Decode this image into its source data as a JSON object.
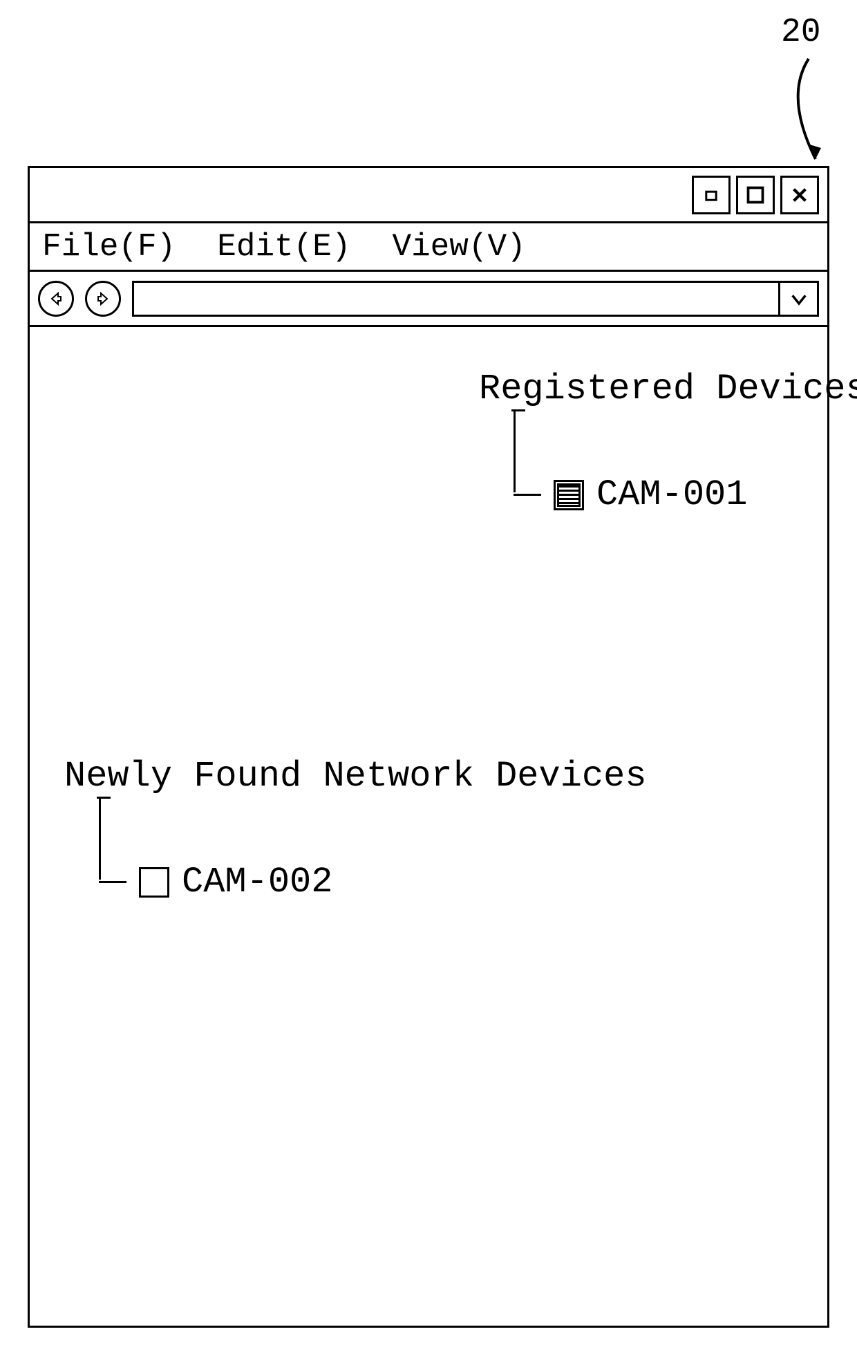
{
  "callout": {
    "label": "20"
  },
  "window_controls": {
    "minimize": "–",
    "maximize": "",
    "close": "✖"
  },
  "menu": {
    "file": "File(F)",
    "edit": "Edit(E)",
    "view": "View(V)"
  },
  "groups": [
    {
      "label": "Registered Devices",
      "items": [
        {
          "icon": "filled",
          "name": "CAM-001"
        }
      ]
    },
    {
      "label": "Newly Found Network Devices",
      "items": [
        {
          "icon": "empty",
          "name": "CAM-002"
        }
      ]
    }
  ]
}
